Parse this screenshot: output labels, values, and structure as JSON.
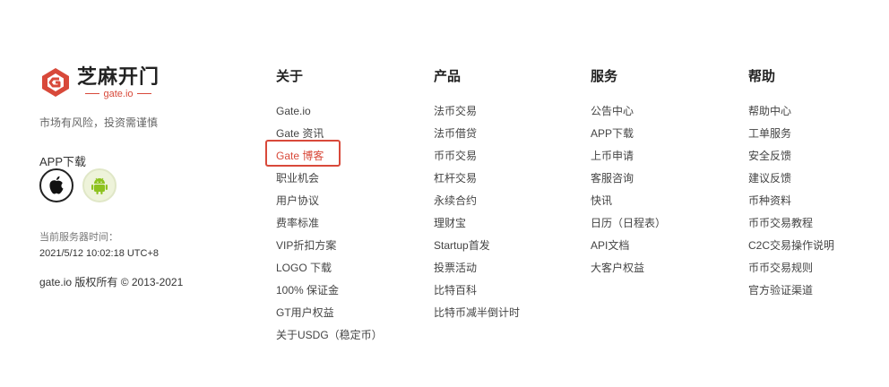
{
  "brand": {
    "logo_cn": "芝麻开门",
    "logo_en": "gate.io",
    "risk_notice": "市场有风险，投资需谨慎",
    "app_download_label": "APP下载",
    "server_time_label": "当前服务器时间：",
    "server_time_value": "2021/5/12 10:02:18 UTC+8",
    "copyright": "gate.io 版权所有 © 2013-2021",
    "accent_color": "#d8493a"
  },
  "columns": [
    {
      "title": "关于",
      "items": [
        "Gate.io",
        "Gate 资讯",
        "Gate 博客",
        "职业机会",
        "用户协议",
        "费率标准",
        "VIP折扣方案",
        "LOGO 下载",
        "100% 保证金",
        "GT用户权益",
        "关于USDG（稳定币）"
      ]
    },
    {
      "title": "产品",
      "items": [
        "法币交易",
        "法币借贷",
        "币币交易",
        "杠杆交易",
        "永续合约",
        "理财宝",
        "Startup首发",
        "投票活动",
        "比特百科",
        "比特币减半倒计时"
      ]
    },
    {
      "title": "服务",
      "items": [
        "公告中心",
        "APP下载",
        "上币申请",
        "客服咨询",
        "快讯",
        "日历（日程表）",
        "API文档",
        "大客户权益"
      ]
    },
    {
      "title": "帮助",
      "items": [
        "帮助中心",
        "工单服务",
        "安全反馈",
        "建议反馈",
        "币种资料",
        "币币交易教程",
        "C2C交易操作说明",
        "币币交易规则",
        "官方验证渠道"
      ]
    }
  ],
  "highlighted_item": "Gate 博客"
}
